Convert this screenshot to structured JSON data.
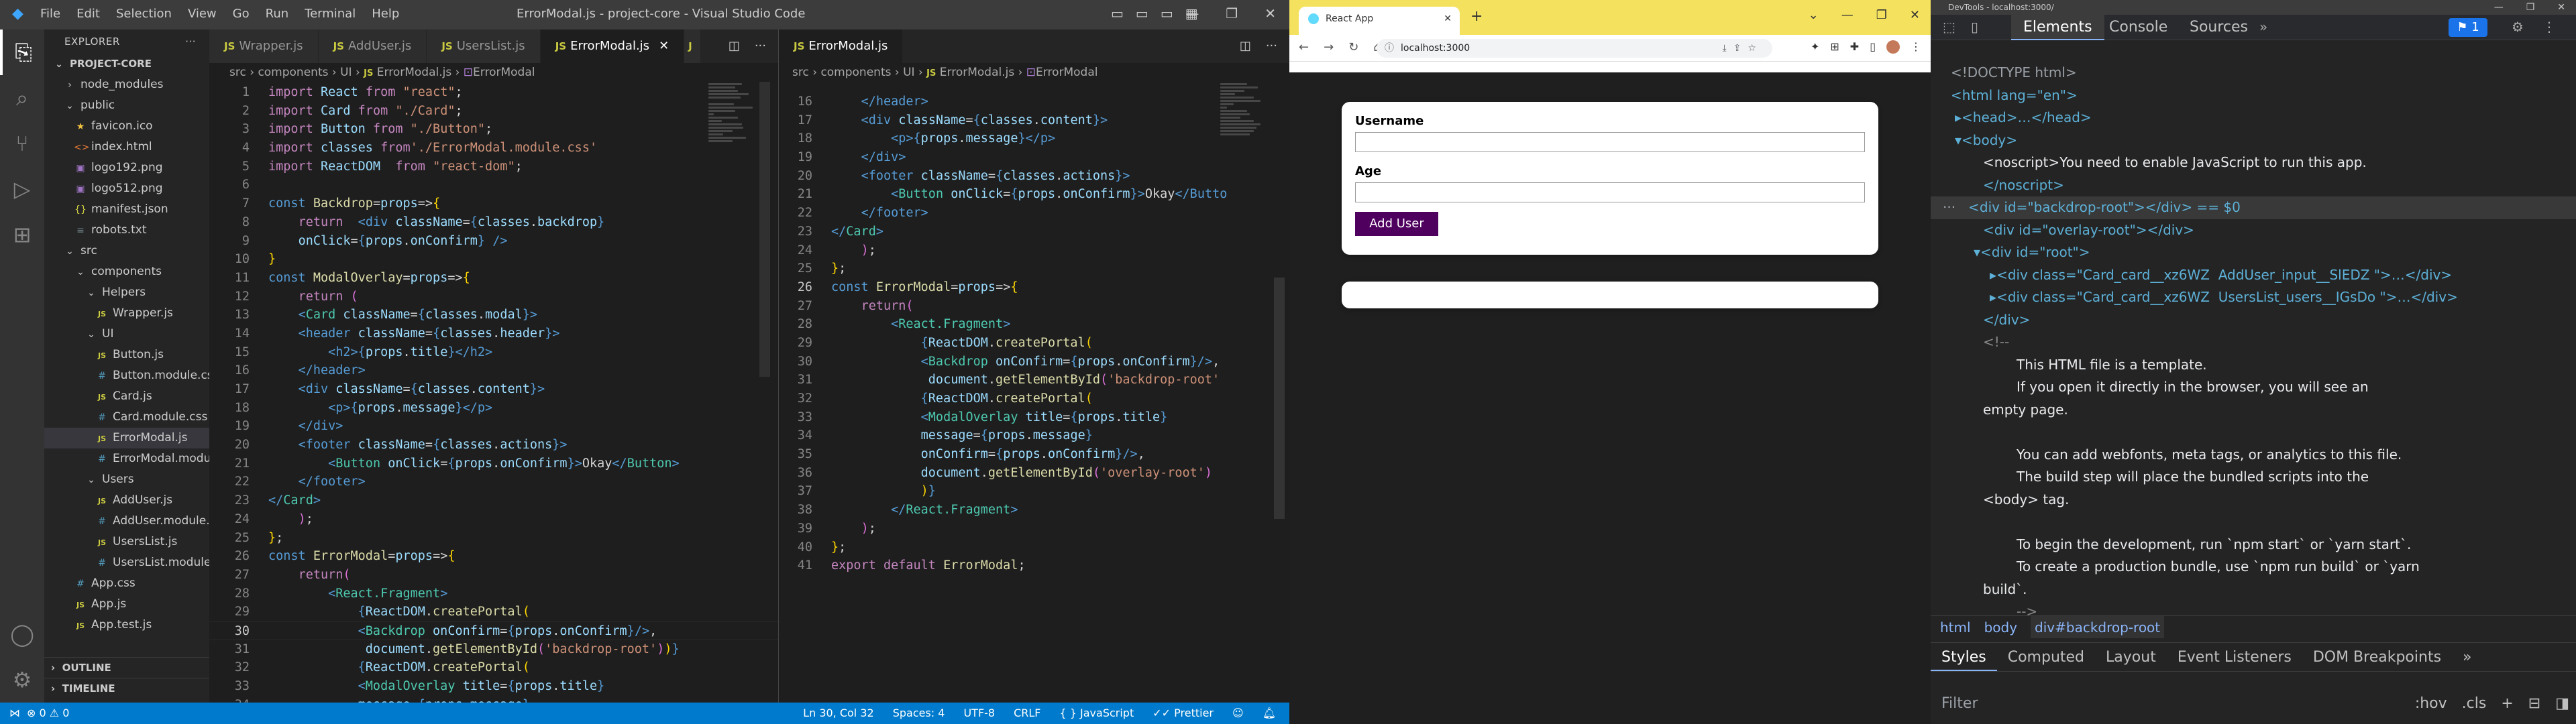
{
  "vscode": {
    "menu": [
      "File",
      "Edit",
      "Selection",
      "View",
      "Go",
      "Run",
      "Terminal",
      "Help"
    ],
    "title": "ErrorModal.js - project-core - Visual Studio Code",
    "explorer_label": "EXPLORER",
    "project": "PROJECT-CORE",
    "tree": [
      {
        "label": "node_modules",
        "depth": 1,
        "type": "folder-closed"
      },
      {
        "label": "public",
        "depth": 1,
        "type": "folder-open"
      },
      {
        "label": "favicon.ico",
        "depth": 2,
        "type": "ico"
      },
      {
        "label": "index.html",
        "depth": 2,
        "type": "html"
      },
      {
        "label": "logo192.png",
        "depth": 2,
        "type": "img"
      },
      {
        "label": "logo512.png",
        "depth": 2,
        "type": "img"
      },
      {
        "label": "manifest.json",
        "depth": 2,
        "type": "json"
      },
      {
        "label": "robots.txt",
        "depth": 2,
        "type": "txt"
      },
      {
        "label": "src",
        "depth": 1,
        "type": "folder-open"
      },
      {
        "label": "components",
        "depth": 2,
        "type": "folder-open"
      },
      {
        "label": "Helpers",
        "depth": 3,
        "type": "folder-open"
      },
      {
        "label": "Wrapper.js",
        "depth": 4,
        "type": "js"
      },
      {
        "label": "UI",
        "depth": 3,
        "type": "folder-open"
      },
      {
        "label": "Button.js",
        "depth": 4,
        "type": "js"
      },
      {
        "label": "Button.module.css",
        "depth": 4,
        "type": "css"
      },
      {
        "label": "Card.js",
        "depth": 4,
        "type": "js"
      },
      {
        "label": "Card.module.css",
        "depth": 4,
        "type": "css"
      },
      {
        "label": "ErrorModal.js",
        "depth": 4,
        "type": "js",
        "selected": true
      },
      {
        "label": "ErrorModal.modu...",
        "depth": 4,
        "type": "css"
      },
      {
        "label": "Users",
        "depth": 3,
        "type": "folder-open"
      },
      {
        "label": "AddUser.js",
        "depth": 4,
        "type": "js"
      },
      {
        "label": "AddUser.module....",
        "depth": 4,
        "type": "css"
      },
      {
        "label": "UsersList.js",
        "depth": 4,
        "type": "js"
      },
      {
        "label": "UsersList.module....",
        "depth": 4,
        "type": "css"
      },
      {
        "label": "App.css",
        "depth": 2,
        "type": "css"
      },
      {
        "label": "App.js",
        "depth": 2,
        "type": "js"
      },
      {
        "label": "App.test.js",
        "depth": 2,
        "type": "js"
      }
    ],
    "outline_label": "OUTLINE",
    "timeline_label": "TIMELINE",
    "left_tabs": [
      "Wrapper.js",
      "AddUser.js",
      "UsersList.js",
      "ErrorModal.js",
      "J"
    ],
    "left_active_tab": 3,
    "right_tabs": [
      "ErrorModal.js"
    ],
    "breadcrumb": [
      "src",
      "components",
      "UI",
      "ErrorModal.js",
      "ErrorModal"
    ],
    "status": {
      "errors": "0",
      "warnings": "0",
      "position": "Ln 30, Col 32",
      "spaces": "Spaces: 4",
      "encoding": "UTF-8",
      "eol": "CRLF",
      "language": "JavaScript",
      "formatter": "Prettier"
    }
  },
  "browser": {
    "tab_title": "React App",
    "url": "localhost:3000",
    "form": {
      "username_label": "Username",
      "age_label": "Age",
      "button_label": "Add User"
    }
  },
  "devtools": {
    "window_title": "DevTools - localhost:3000/",
    "tabs": [
      "Elements",
      "Console",
      "Sources"
    ],
    "badge": "1",
    "elements": [
      "<!DOCTYPE html>",
      "<html lang=\"en\">",
      "▸<head>…</head>",
      "▾<body>",
      "<noscript>You need to enable JavaScript to run this app.",
      "</noscript>",
      "<div id=\"backdrop-root\"></div> == $0",
      "<div id=\"overlay-root\"></div>",
      "▾<div id=\"root\">",
      "▸<div class=\"Card_card__xz6WZ  AddUser_input__SlEDZ \">…</div>",
      "▸<div class=\"Card_card__xz6WZ  UsersList_users__IGsDo \">…</div>",
      "</div>",
      "<!--",
      "This HTML file is a template.",
      "If you open it directly in the browser, you will see an",
      "empty page.",
      "",
      "You can add webfonts, meta tags, or analytics to this file.",
      "The build step will place the bundled scripts into the",
      "<body> tag.",
      "",
      "To begin the development, run `npm start` or `yarn start`.",
      "To create a production bundle, use `npm run build` or `yarn",
      "build`.",
      "-->"
    ],
    "crumbs": [
      "html",
      "body",
      "div#backdrop-root"
    ],
    "subtabs": [
      "Styles",
      "Computed",
      "Layout",
      "Event Listeners",
      "DOM Breakpoints"
    ],
    "filter_placeholder": "Filter",
    "filter_right": [
      ":hov",
      ".cls",
      "+"
    ]
  }
}
